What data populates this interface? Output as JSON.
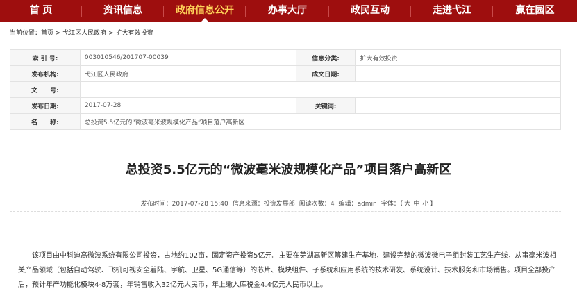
{
  "nav": {
    "items": [
      {
        "label": "首 页",
        "active": false
      },
      {
        "label": "资讯信息",
        "active": false
      },
      {
        "label": "政府信息公开",
        "active": true
      },
      {
        "label": "办事大厅",
        "active": false
      },
      {
        "label": "政民互动",
        "active": false
      },
      {
        "label": "走进弋江",
        "active": false
      },
      {
        "label": "赢在园区",
        "active": false
      }
    ]
  },
  "breadcrumb": {
    "prefix": "当前位置：",
    "home": "首页",
    "sep1": " > ",
    "level1": "弋江区人民政府",
    "sep2": " > ",
    "level2": "扩大有效投资"
  },
  "meta": {
    "index_label": "索 引 号:",
    "index_value": "003010546/201707-00039",
    "category_label": "信息分类:",
    "category_value": "扩大有效投资",
    "publisher_label": "发布机构:",
    "publisher_value": "弋江区人民政府",
    "created_label": "成文日期:",
    "created_value": "",
    "docno_label": "文　　号:",
    "docno_value": "",
    "date_label": "发布日期:",
    "date_value": "2017-07-28",
    "keywords_label": "关键词:",
    "keywords_value": "",
    "name_label": "名　　称:",
    "name_value": "总投资5.5亿元的“微波毫米波规模化产品”项目落户高新区"
  },
  "article": {
    "title": "总投资5.5亿元的“微波毫米波规模化产品”项目落户高新区",
    "info": {
      "time_label": "发布时间：",
      "time": "2017-07-28 15:40",
      "source_label": "信息来源：",
      "source": "投资发展部",
      "reads_label": "阅读次数：",
      "reads": "4",
      "editor_label": "编辑：",
      "editor": "admin",
      "font_label": "字体：",
      "font_open": "【",
      "font_large": "大",
      "font_medium": "中",
      "font_small": "小",
      "font_close": "】"
    },
    "body": "该项目由中科迪高微波系统有限公司投资，占地约102亩，固定资产投资5亿元。主要在芜湖高新区筹建生产基地，建设完整的微波微电子组封装工艺生产线，从事毫米波相关产品领域（包括自动驾驶、飞机可视安全着陆、宇航、卫星、5G通信等）的芯片、模块组件、子系统和应用系统的技术研发、系统设计、技术服务和市场销售。项目全部投产后，预计年产功能化模块4-8万套，年销售收入32亿元人民币，年上缴入库税金4.4亿元人民币以上。"
  },
  "colors": {
    "nav_bg": "#9e0e0e",
    "nav_active": "#ffd35a"
  }
}
